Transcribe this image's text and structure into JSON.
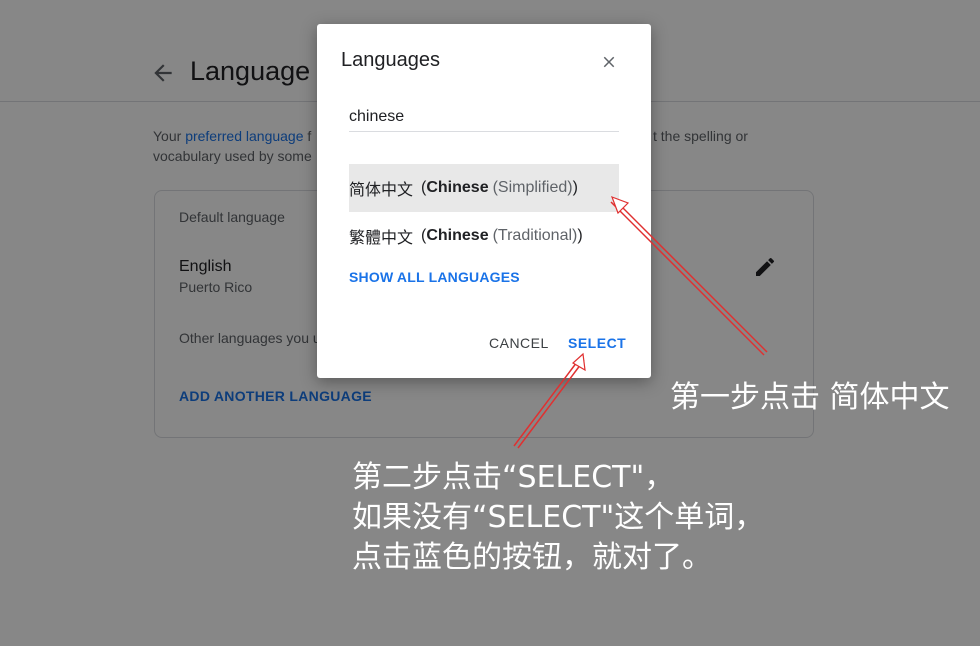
{
  "page": {
    "title": "Language",
    "intro_prefix": "Your ",
    "intro_link": "preferred language",
    "intro_tail": " f",
    "intro_line2": "vocabulary used by some",
    "intro_right": "t the spelling or",
    "card": {
      "default_label": "Default language",
      "language": "English",
      "region": "Puerto Rico",
      "other_label": "Other languages you u",
      "add_button": "ADD ANOTHER LANGUAGE"
    }
  },
  "dialog": {
    "title": "Languages",
    "search_value": "chinese",
    "options": [
      {
        "native": "简体中文",
        "open": "(",
        "english": "Chinese",
        "variant": "(Simplified)",
        "close": ")",
        "selected": true
      },
      {
        "native": "繁體中文",
        "open": "(",
        "english": "Chinese",
        "variant": "(Traditional)",
        "close": ")",
        "selected": false
      }
    ],
    "show_all": "SHOW ALL LANGUAGES",
    "cancel": "CANCEL",
    "select": "SELECT"
  },
  "annotations": {
    "step1": "第一步点击 简体中文",
    "step2_lines": [
      "第二步点击“SELECT\"，",
      "如果没有“SELECT\"这个单词，",
      "点击蓝色的按钮，就对了。"
    ]
  },
  "colors": {
    "accent": "#1a73e8",
    "annotation_arrow": "#e03030",
    "scrim": "#777777"
  }
}
